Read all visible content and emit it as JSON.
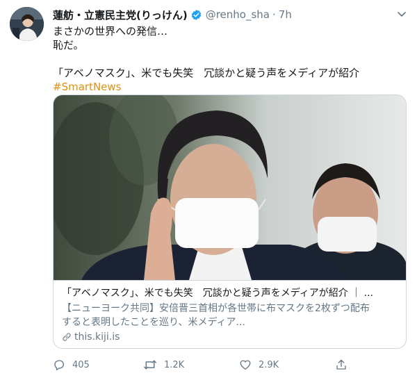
{
  "tweet": {
    "display_name": "蓮舫・立憲民主党(りっけん)",
    "handle": "@renho_sha",
    "separator": "·",
    "time": "7h",
    "text_lines": [
      "まさかの世界への発信…",
      "恥だ。",
      "「アベノマスク」、米でも失笑　冗談かと疑う声をメディアが紹介"
    ],
    "hashtag": "#SmartNews"
  },
  "card": {
    "title": "「アベノマスク」、米でも失笑　冗談かと疑う声をメディアが紹介 ｜ ...",
    "description_line1": "【ニューヨーク共同】安倍晋三首相が各世帯に布マスクを2枚ずつ配布",
    "description_line2": "すると表明したことを巡り、米メディア...",
    "domain": "this.kiji.is"
  },
  "actions": {
    "reply_count": "405",
    "retweet_count": "1.2K",
    "like_count": "2.9K"
  },
  "colors": {
    "hashtag": "#e0900f",
    "secondary_text": "#657786",
    "verified_badge": "#1da1f2",
    "border": "#ccd6dd"
  },
  "icons": {
    "verified": "verified-badge-icon",
    "menu": "chevron-down-icon",
    "reply": "reply-icon",
    "retweet": "retweet-icon",
    "like": "heart-icon",
    "share": "share-icon",
    "link": "link-icon"
  }
}
